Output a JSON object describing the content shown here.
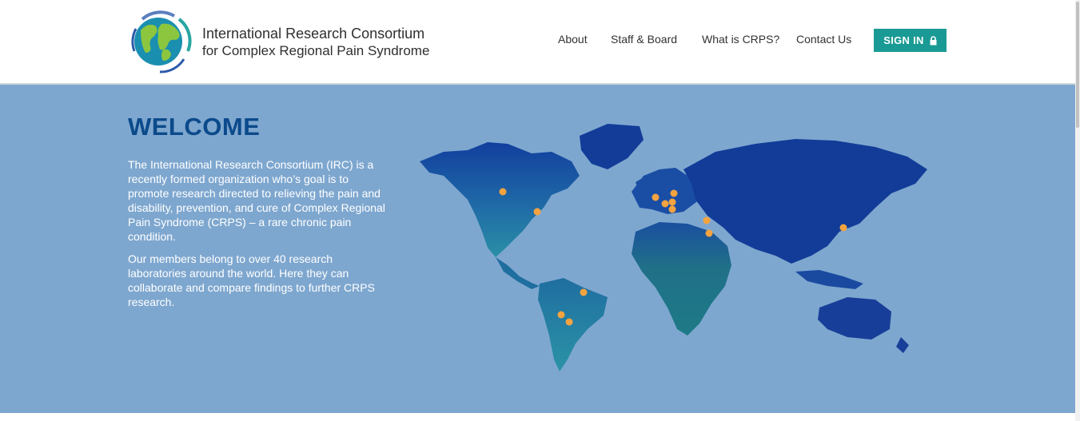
{
  "header": {
    "brand": {
      "line1": "International Research Consortium",
      "line2": "for Complex Regional Pain Syndrome"
    },
    "nav": [
      "About",
      "Staff & Board",
      "What is CRPS?",
      "Contact Us"
    ],
    "signin_label": "SIGN IN"
  },
  "hero": {
    "title": "WELCOME",
    "paragraph1": "The International Research Consortium (IRC) is a recently formed organization who’s goal is to promote research directed to relieving the pain and disability, prevention, and cure of Complex Regional Pain Syndrome (CRPS) – a rare chronic pain condition.",
    "paragraph2": "Our members belong to over 40 research laboratories around the world. Here they can collaborate and compare findings to further CRPS research."
  },
  "colors": {
    "accent": "#1a9a94",
    "hero_bg": "#7ea7cf",
    "title": "#0b4a8b",
    "map_land": "#1546a0",
    "map_dot": "#f4a340"
  },
  "icons": [
    "globe-logo-icon",
    "lock-icon",
    "world-map-image"
  ]
}
